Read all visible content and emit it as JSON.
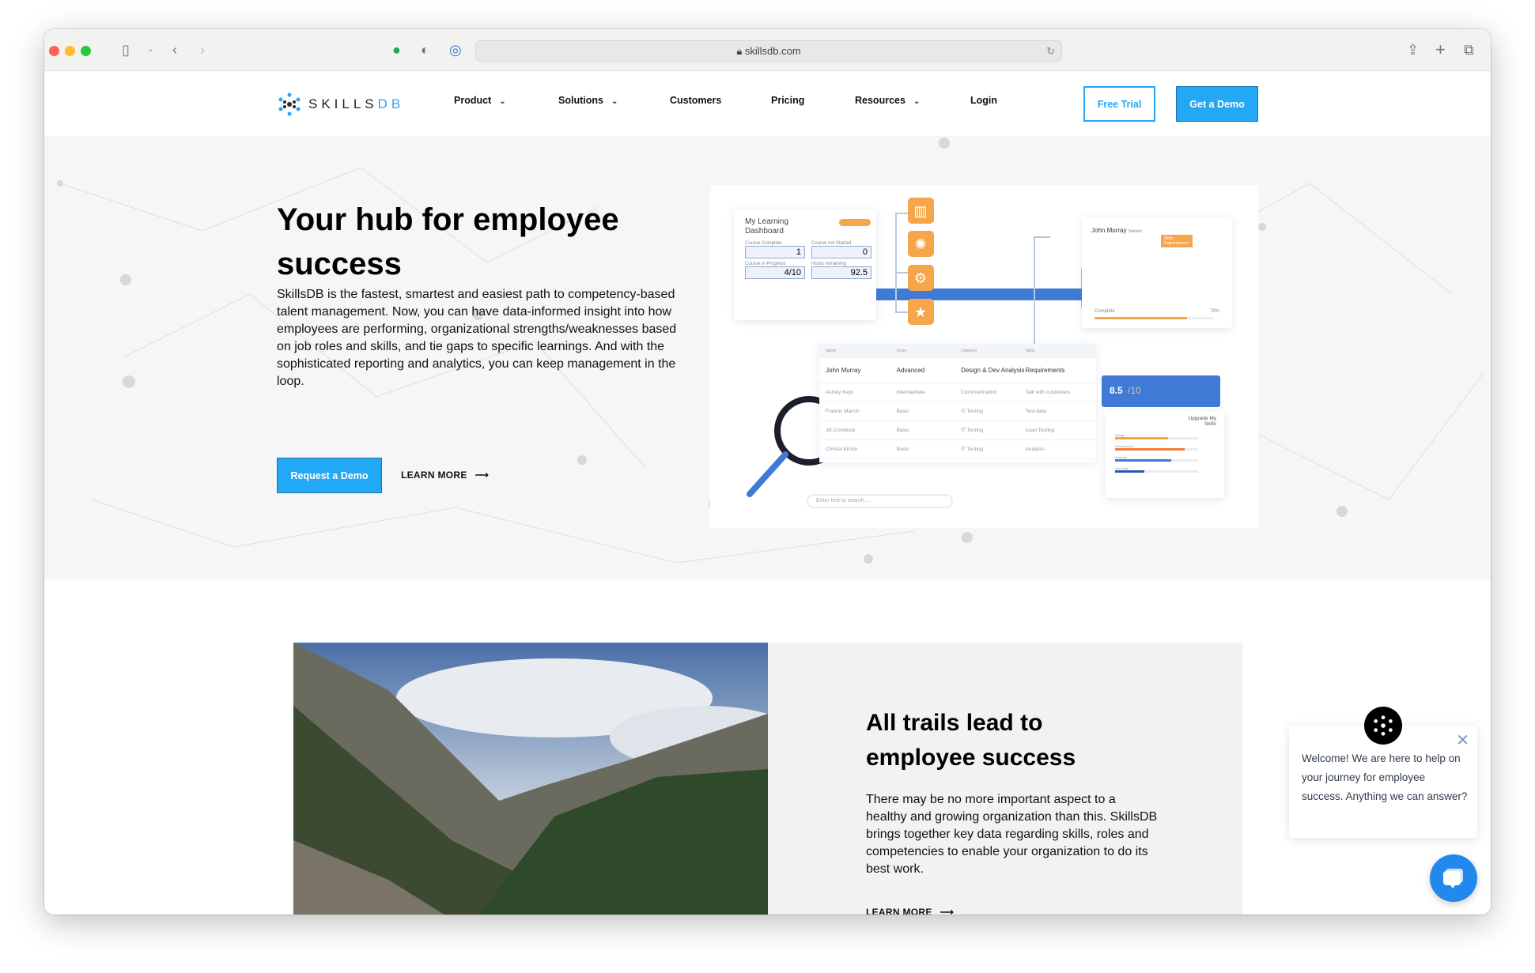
{
  "browser": {
    "url": "skillsdb.com"
  },
  "nav": {
    "logo_text": "SKILLS",
    "logo_text_accent": "DB",
    "items": [
      {
        "label": "Product",
        "has_dropdown": true
      },
      {
        "label": "Solutions",
        "has_dropdown": true
      },
      {
        "label": "Customers",
        "has_dropdown": false
      },
      {
        "label": "Pricing",
        "has_dropdown": false
      },
      {
        "label": "Resources",
        "has_dropdown": true
      },
      {
        "label": "Login",
        "has_dropdown": false
      }
    ],
    "free_trial": "Free Trial",
    "get_demo": "Get a Demo"
  },
  "hero": {
    "title": "Your hub for employee success",
    "body": "SkillsDB is the fastest, smartest and easiest path to competency-based talent management. Now, you can have data-informed insight into how employees are performing, organizational strengths/weaknesses based on job roles and skills, and tie gaps to specific learnings. And with the sophisticated reporting and analytics, you can keep management in the loop.",
    "request_demo": "Request a Demo",
    "learn_more": "LEARN MORE"
  },
  "illustration": {
    "dashboard_title": "My Learning Dashboard",
    "stats": [
      {
        "label": "Course Complete",
        "value": "1"
      },
      {
        "label": "Course not Started",
        "value": "0"
      },
      {
        "label": "Course in Progress",
        "value": "4/10"
      },
      {
        "label": "Hours remaining",
        "value": "92.5"
      }
    ],
    "statistic_title": "John Murray",
    "statistic_sub": "Statistic",
    "statistic_tag": "Skills Requirements",
    "complete_label": "Complete",
    "complete_value": "78%",
    "complete_fraction": 0.78,
    "table_headers": [
      "Name",
      "Score",
      "Category",
      "Skills"
    ],
    "table_rows": [
      [
        "John Murray",
        "Advanced",
        "Design & Dev Analysis",
        "Requirements"
      ],
      [
        "Ashley Kept",
        "Intermediate",
        "Communication",
        "Talk with customers"
      ],
      [
        "Francis Marcin",
        "Basic",
        "IT Testing",
        "Test data"
      ],
      [
        "Jill Cronbook",
        "Basic",
        "IT Testing",
        "Load Testing"
      ],
      [
        "Christa Kirsch",
        "Basic",
        "IT Testing",
        "Analysis"
      ]
    ],
    "score": "8.5",
    "score_max": "/10",
    "upgrade_title": "Upgrade My Skills",
    "skills": [
      {
        "label": "Design",
        "level": 0.64,
        "color": "#f5a54a"
      },
      {
        "label": "Development",
        "level": 0.84,
        "color": "#f07c3a"
      },
      {
        "label": "Analysis",
        "level": 0.68,
        "color": "#3f7bd6"
      },
      {
        "label": "Test Data",
        "level": 0.35,
        "color": "#2b55b0"
      }
    ],
    "search_placeholder": "Enter text to search...."
  },
  "section2": {
    "title": "All trails lead to employee success",
    "body": "There may be no more important aspect to a healthy and growing organization than this. SkillsDB brings together key data regarding skills, roles and competencies to enable your organization to do its best work.",
    "learn_more": "LEARN MORE"
  },
  "chat": {
    "message": "Welcome! We are here to help on your journey for employee success. Anything we can answer?"
  },
  "colors": {
    "brand": "#23a8f5",
    "accent_orange": "#f5a54a",
    "accent_blue": "#3f7bd6",
    "chat_blue": "#2188ee"
  }
}
